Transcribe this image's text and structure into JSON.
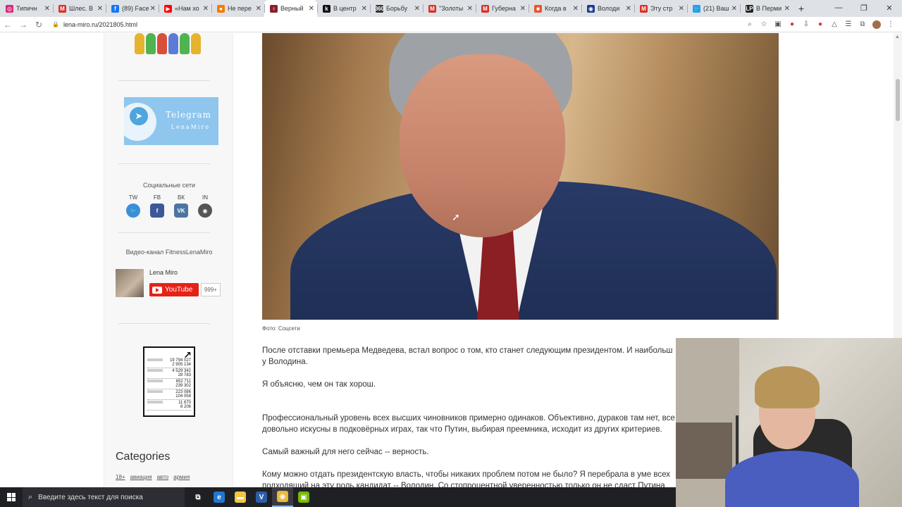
{
  "browser": {
    "tabs": [
      {
        "label": "Типичн",
        "color": "#d62976",
        "glyph": "◎"
      },
      {
        "label": "Шлес. В",
        "color": "#d93025",
        "glyph": "M"
      },
      {
        "label": "(89) Face",
        "color": "#1877f2",
        "glyph": "f"
      },
      {
        "label": "«Нам хо",
        "color": "#ff0000",
        "glyph": "▶"
      },
      {
        "label": "Не пере",
        "color": "#f57c00",
        "glyph": "●"
      },
      {
        "label": "Верный",
        "color": "#8b1e2b",
        "glyph": "♀",
        "active": true
      },
      {
        "label": "В центр",
        "color": "#111111",
        "glyph": "k"
      },
      {
        "label": "Борьбу",
        "color": "#333333",
        "glyph": "360"
      },
      {
        "label": "\"Золоты",
        "color": "#d93025",
        "glyph": "M"
      },
      {
        "label": "Губерна",
        "color": "#d93025",
        "glyph": "M"
      },
      {
        "label": "Когда в",
        "color": "#e8542e",
        "glyph": "■"
      },
      {
        "label": "Володи",
        "color": "#1a3b8f",
        "glyph": "◉"
      },
      {
        "label": "Эту стр",
        "color": "#d93025",
        "glyph": "M"
      },
      {
        "label": "(21) Ваш",
        "color": "#1da1f2",
        "glyph": "🐦"
      },
      {
        "label": "В Перми",
        "color": "#222222",
        "glyph": "LP"
      }
    ],
    "url": "lena-miro.ru/2021805.html",
    "window_controls": [
      "—",
      "❐",
      "✕"
    ]
  },
  "sidebar": {
    "telegram": {
      "title": "Telegram",
      "subtitle": "LenaMiro"
    },
    "social_title": "Социальные сети",
    "social": [
      {
        "label": "TW",
        "color": "#3b8fd8",
        "glyph": "🐦"
      },
      {
        "label": "FB",
        "color": "#3b5998",
        "glyph": "f"
      },
      {
        "label": "ВК",
        "color": "#4c75a3",
        "glyph": "VK"
      },
      {
        "label": "IN",
        "color": "#555555",
        "glyph": "◉"
      }
    ],
    "video_title": "Видео-канал FitnessLenaMiro",
    "youtube": {
      "name": "Lena Miro",
      "button": "YouTube",
      "count": "999+"
    },
    "liveinternet": [
      [
        "19 794 027",
        "2 905 134"
      ],
      [
        "4 529 342",
        "28 783"
      ],
      [
        "652 711",
        "239 302"
      ],
      [
        "223 086",
        "104 058"
      ],
      [
        "11 670",
        "8 206"
      ]
    ],
    "categories_title": "Categories",
    "categories": [
      "18+",
      "авиация",
      "авто",
      "армия"
    ]
  },
  "article": {
    "caption": "Фото: Соцсети",
    "paragraphs": [
      "После отставки премьера Медведева, встал вопрос о том, кто станет следующим президентом. И наибольш",
      "у Володина.",
      "Я объясню, чем он так хорош.",
      "Профессиональный уровень всех высших чиновников примерно одинаков. Объективно, дураков там нет, все",
      "довольно искусны в подковёрных играх, так что Путин, выбирая преемника, исходит из других критериев.",
      "Самый важный для него сейчас -- верность.",
      "Кому можно отдать президентскую власть, чтобы никаких проблем потом не было? Я перебрала в уме всех",
      "подходящий на эту роль кандидат -- Володин. Со стопроцентной уверенностью только он не сдаст Путина"
    ]
  },
  "taskbar": {
    "search_placeholder": "Введите здесь текст для поиска",
    "apps": [
      {
        "name": "task-view",
        "glyph": "⧉",
        "color": "#1f2024"
      },
      {
        "name": "edge",
        "glyph": "e",
        "color": "#1f78d1"
      },
      {
        "name": "explorer",
        "glyph": "▬",
        "color": "#f4c542"
      },
      {
        "name": "v-app",
        "glyph": "V",
        "color": "#2a5fa8"
      },
      {
        "name": "chrome",
        "glyph": "◉",
        "color": "#e9b93b",
        "active": true
      },
      {
        "name": "nvidia",
        "glyph": "▣",
        "color": "#76b900"
      }
    ]
  }
}
